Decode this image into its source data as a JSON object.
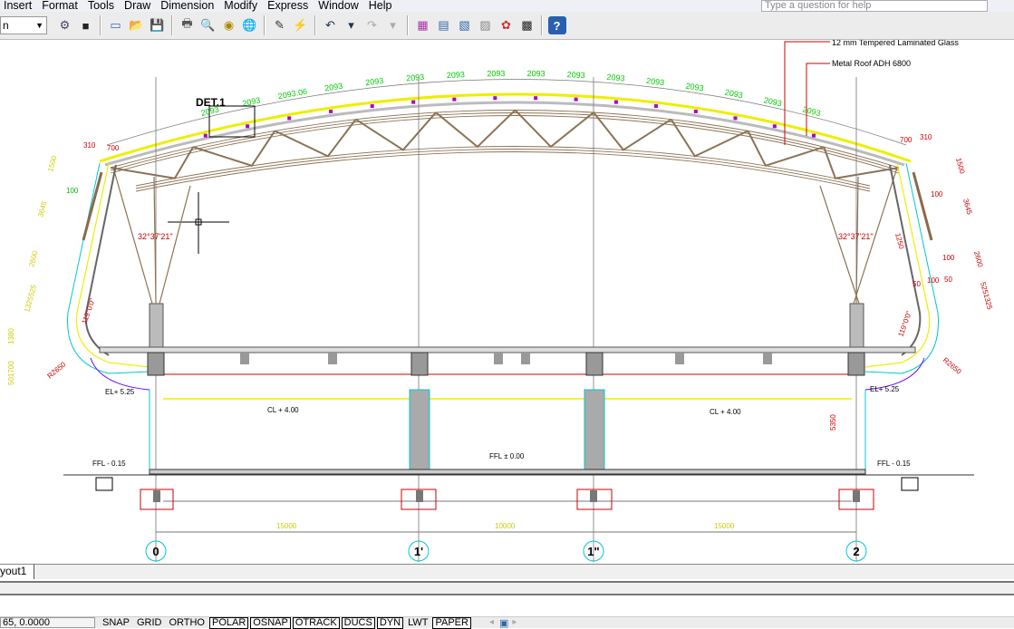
{
  "menu": [
    "Insert",
    "Format",
    "Tools",
    "Draw",
    "Dimension",
    "Modify",
    "Express",
    "Window",
    "Help"
  ],
  "help_placeholder": "Type a question for help",
  "workspace_select": "n",
  "toolbar_icons": [
    {
      "name": "gear-icon",
      "glyph": "⚙",
      "color": "#446"
    },
    {
      "name": "workspace-icon",
      "glyph": "■",
      "color": "#222"
    },
    "sep",
    {
      "name": "new-icon",
      "glyph": "▭",
      "color": "#36c"
    },
    {
      "name": "open-icon",
      "glyph": "📂",
      "color": "#c90"
    },
    {
      "name": "save-icon",
      "glyph": "💾",
      "color": "#36a"
    },
    "sep",
    {
      "name": "plot-icon",
      "glyph": "🖶",
      "color": "#555"
    },
    {
      "name": "plot-preview-icon",
      "glyph": "🔍",
      "color": "#36a"
    },
    {
      "name": "publish-icon",
      "glyph": "◉",
      "color": "#a80"
    },
    {
      "name": "web-icon",
      "glyph": "🌐",
      "color": "#393"
    },
    "sep",
    {
      "name": "brush-icon",
      "glyph": "✎",
      "color": "#333"
    },
    {
      "name": "lightning-icon",
      "glyph": "⚡",
      "color": "#c60"
    },
    "sep",
    {
      "name": "undo-icon",
      "glyph": "↶",
      "color": "#235"
    },
    {
      "name": "undo-dropdown-icon",
      "glyph": "▾",
      "color": "#235"
    },
    {
      "name": "redo-icon",
      "glyph": "↷",
      "color": "#aaa"
    },
    {
      "name": "redo-dropdown-icon",
      "glyph": "▾",
      "color": "#aaa"
    },
    "sep",
    {
      "name": "properties-icon",
      "glyph": "▦",
      "color": "#a3a"
    },
    {
      "name": "design-center-icon",
      "glyph": "▤",
      "color": "#36a"
    },
    {
      "name": "tool-palettes-icon",
      "glyph": "▧",
      "color": "#36a"
    },
    {
      "name": "sheet-set-icon",
      "glyph": "▨",
      "color": "#888"
    },
    {
      "name": "markup-icon",
      "glyph": "✿",
      "color": "#c33"
    },
    {
      "name": "calculator-icon",
      "glyph": "▩",
      "color": "#222"
    },
    "sep",
    {
      "name": "help-icon",
      "glyph": "?",
      "color": "#fff"
    }
  ],
  "drawing": {
    "annotations": {
      "glass": "12 mm Tempered Laminated Glass",
      "roof": "Metal Roof ADH 6800",
      "detail": "DET.1"
    },
    "arch_dims": [
      "2093",
      "2093",
      "2093.06",
      "2093",
      "2093",
      "2093",
      "2093",
      "2093",
      "2093",
      "2093",
      "2093",
      "2093",
      "2093",
      "2093",
      "2093",
      "2093"
    ],
    "left_dims": {
      "a": "310",
      "b": "700",
      "c": "1500",
      "d": "100",
      "e": "3645",
      "f": "2600",
      "g": "1325525",
      "h": "1380",
      "i": "501700",
      "radius": "R2650",
      "angle": "119°0'0\"",
      "truss_angle": "32°37'21\""
    },
    "right_dims": {
      "a": "700",
      "b": "310",
      "c": "1500",
      "d": "100",
      "e": "3645",
      "f": "1250",
      "g": "100",
      "h": "2600",
      "i": "50",
      "j": "100",
      "k": "50",
      "l": "5251325",
      "radius": "R2650",
      "angle": "119°0'0\"",
      "truss_angle": "32°37'21\""
    },
    "levels": {
      "el_left": "EL+ 5.25",
      "el_right": "EL+ 5.25",
      "cl_left": "CL + 4.00",
      "cl_right": "CL + 4.00",
      "ffl_mid": "FFL ± 0.00",
      "ffl_left": "FFL - 0.15",
      "ffl_right": "FFL - 0.15",
      "height": "5350"
    },
    "spans": [
      "15000",
      "10000",
      "15000"
    ],
    "grid_labels": [
      "0",
      "1'",
      "1\"",
      "2"
    ]
  },
  "layout_tab": "yout1",
  "status": {
    "coords": "65, 0.0000",
    "buttons": [
      {
        "label": "SNAP",
        "on": false
      },
      {
        "label": "GRID",
        "on": false
      },
      {
        "label": "ORTHO",
        "on": false
      },
      {
        "label": "POLAR",
        "on": true
      },
      {
        "label": "OSNAP",
        "on": true
      },
      {
        "label": "OTRACK",
        "on": true
      },
      {
        "label": "DUCS",
        "on": true
      },
      {
        "label": "DYN",
        "on": true
      },
      {
        "label": "LWT",
        "on": false
      },
      {
        "label": "PAPER",
        "on": true
      }
    ]
  }
}
